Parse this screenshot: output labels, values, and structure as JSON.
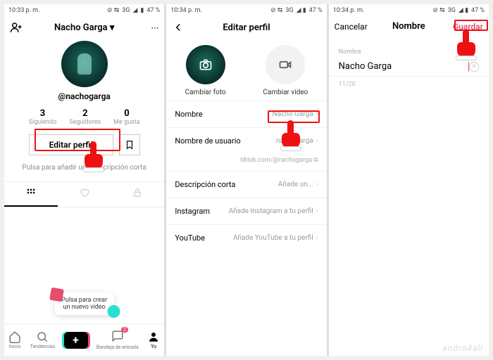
{
  "status": {
    "time1": "10:33 p. m.",
    "time2": "10:34 p. m.",
    "time3": "10:34 p. m.",
    "network": "3G",
    "battery": "47 %"
  },
  "pane1": {
    "title": "Nacho Garga",
    "handle": "@nachogarga",
    "stats": [
      {
        "num": "3",
        "lbl": "Siguiendo"
      },
      {
        "num": "2",
        "lbl": "Seguidores"
      },
      {
        "num": "0",
        "lbl": "Me gusta"
      }
    ],
    "edit_label": "Editar perfil",
    "short_desc": "Pulsa para añadir una descripción corta",
    "tooltip": "Pulsa para crear\nun nuevo vídeo",
    "nav": [
      "Inicio",
      "Tendencias",
      "",
      "Bandeja de entrada",
      "Yo"
    ],
    "inbox_badge": "2"
  },
  "pane2": {
    "title": "Editar perfil",
    "photo_label": "Cambiar foto",
    "video_label": "Cambiar vídeo",
    "rows": {
      "name_k": "Nombre",
      "name_v": "Nacho Garga",
      "user_k": "Nombre de usuario",
      "user_v": "nachogarga",
      "url": "tiktok.com/@nachogarga",
      "desc_k": "Descripción corta",
      "desc_v": "Añade un...",
      "ig_k": "Instagram",
      "ig_v": "Añade Instagram a tu perfil",
      "yt_k": "YouTube",
      "yt_v": "Añade YouTube a tu perfil"
    }
  },
  "pane3": {
    "cancel": "Cancelar",
    "title": "Nombre",
    "save": "Guardar",
    "field_label": "Nombre",
    "input_value": "Nacho Garga",
    "counter": "11/20"
  },
  "watermark": "andro4all"
}
